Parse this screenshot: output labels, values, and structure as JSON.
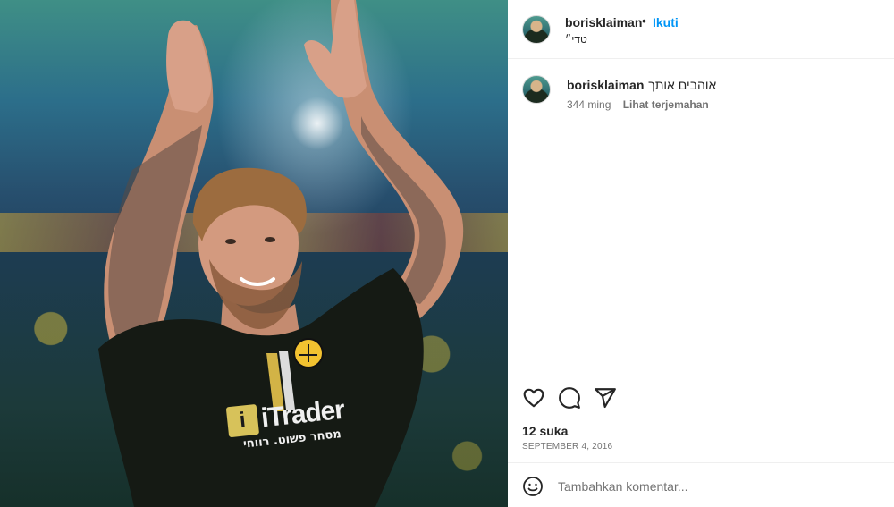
{
  "post": {
    "image_alt": "Pemain sepak bola bertato bertepuk tangan dengan jersey hitam",
    "jersey_sponsor": "iTrader",
    "jersey_sponsor_sub": "מסחר פשוט. רווחי",
    "crest_color": "#f2c230"
  },
  "header": {
    "username": "borisklaiman",
    "separator": "•",
    "follow_label": "Ikuti",
    "location": "טדי״"
  },
  "comment": {
    "username": "borisklaiman",
    "text": "אוהבים אותך",
    "time": "344 ming",
    "translate_label": "Lihat terjemahan"
  },
  "actions": {
    "like_icon": "heart-icon",
    "comment_icon": "comment-icon",
    "share_icon": "share-icon"
  },
  "likes": "12 suka",
  "date": "SEPTEMBER 4, 2016",
  "add_comment": {
    "placeholder": "Tambahkan komentar...",
    "emoji_icon": "emoji-icon"
  },
  "colors": {
    "follow": "#0095f6",
    "text": "#262626",
    "secondary": "#737373",
    "divider": "#efefef"
  }
}
